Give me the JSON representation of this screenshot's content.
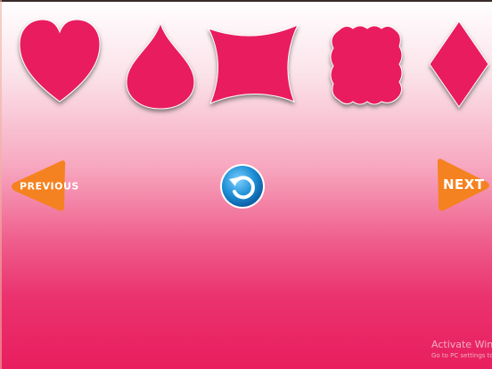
{
  "shapes": [
    {
      "name": "heart-shape"
    },
    {
      "name": "drop-shape"
    },
    {
      "name": "four-point-star-shape"
    },
    {
      "name": "cloud-square-shape"
    },
    {
      "name": "diamond-shape"
    }
  ],
  "colors": {
    "shape_fill": "#e91e5f",
    "button_orange": "#f58220",
    "restart_blue": "#1e90d6",
    "background_bottom": "#e91e5f"
  },
  "nav": {
    "previous_label": "PREVIOUS",
    "next_label": "NEXT"
  },
  "restart": {
    "icon": "restart-icon"
  },
  "watermark": {
    "title": "Activate Windo",
    "subtitle": "Go to PC settings to"
  }
}
